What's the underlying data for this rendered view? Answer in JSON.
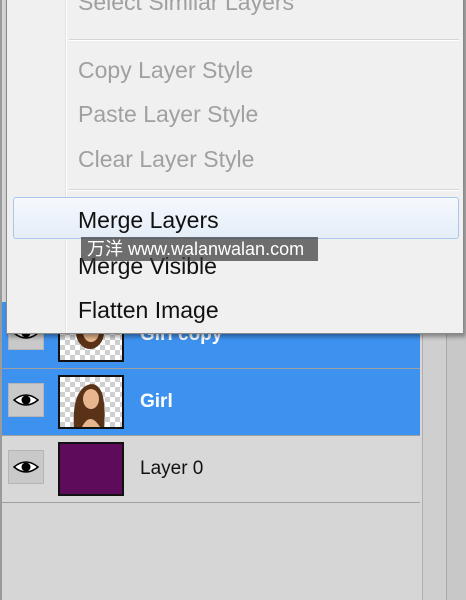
{
  "menu": {
    "items": [
      {
        "label": "Select Similar Layers",
        "enabled": false
      },
      {
        "label": "Copy Layer Style",
        "enabled": false
      },
      {
        "label": "Paste Layer Style",
        "enabled": false
      },
      {
        "label": "Clear Layer Style",
        "enabled": false
      },
      {
        "label": "Merge Layers",
        "enabled": true,
        "highlighted": true
      },
      {
        "label": "Merge Visible",
        "enabled": true
      },
      {
        "label": "Flatten Image",
        "enabled": true
      }
    ]
  },
  "layers": [
    {
      "name": "Girl copy",
      "selected": true,
      "visible": true,
      "thumbnail": "girl-on-transparent"
    },
    {
      "name": "Girl",
      "selected": true,
      "visible": true,
      "thumbnail": "girl-on-transparent"
    },
    {
      "name": "Layer 0",
      "selected": false,
      "visible": true,
      "thumbnail": "solid-fill",
      "fill_color": "#5e0b5c"
    }
  ],
  "colors": {
    "selection": "#3d92f0",
    "menu_background": "#f0f0f0",
    "menu_highlight_border": "#a8c7ea"
  },
  "watermark": {
    "text": "万洋 www.walanwalan.com"
  }
}
